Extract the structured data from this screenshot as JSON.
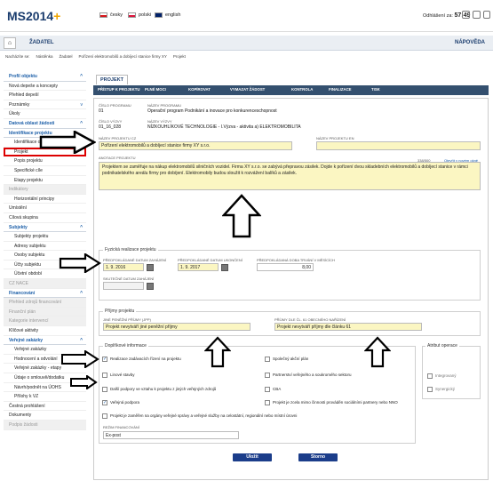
{
  "header": {
    "logo_text": "MS2014",
    "logo_plus": "+",
    "languages": [
      "česky",
      "polski",
      "english"
    ],
    "logout_label": "Odhlášení za:",
    "logout_time": "57:49"
  },
  "nav": {
    "zadatel": "ŽADATEL",
    "napoveda": "NÁPOVĚDA"
  },
  "breadcrumb": [
    "Nacházíte se:",
    "Nástěnka",
    "Žadatel",
    "Pořízení elektromobilů a dobíjecí stanice firmy XY",
    "Projekt"
  ],
  "sidebar": {
    "items": [
      {
        "label": "Profil objektu",
        "kind": "section",
        "chevron": "^"
      },
      {
        "label": "Nová depeše a koncepty",
        "kind": "item"
      },
      {
        "label": "Přehled depeší",
        "kind": "item"
      },
      {
        "label": "Poznámky",
        "kind": "item",
        "chevron": "v"
      },
      {
        "label": "Úkoly",
        "kind": "item"
      },
      {
        "label": "Datová oblast žádosti",
        "kind": "section",
        "chevron": "^"
      },
      {
        "label": "Identifikace projektu",
        "kind": "section"
      },
      {
        "label": "Identifikace operace",
        "kind": "sub"
      },
      {
        "label": "Projekt",
        "kind": "sub",
        "highlight": true
      },
      {
        "label": "Popis projektu",
        "kind": "sub"
      },
      {
        "label": "Specifické cíle",
        "kind": "sub"
      },
      {
        "label": "Etapy projektu",
        "kind": "sub"
      },
      {
        "label": "Indikátory",
        "kind": "grey"
      },
      {
        "label": "Horizontální principy",
        "kind": "sub"
      },
      {
        "label": "Umístění",
        "kind": "item"
      },
      {
        "label": "Cílová skupina",
        "kind": "item"
      },
      {
        "label": "Subjekty",
        "kind": "section",
        "chevron": "^"
      },
      {
        "label": "Subjekty projektu",
        "kind": "sub"
      },
      {
        "label": "Adresy subjektu",
        "kind": "sub"
      },
      {
        "label": "Osoby subjektu",
        "kind": "sub"
      },
      {
        "label": "Účty subjektu",
        "kind": "sub"
      },
      {
        "label": "Účetní období",
        "kind": "sub"
      },
      {
        "label": "CZ NACE",
        "kind": "grey"
      },
      {
        "label": "Financování",
        "kind": "section",
        "chevron": "^"
      },
      {
        "label": "Přehled zdrojů financování",
        "kind": "grey"
      },
      {
        "label": "Finanční plán",
        "kind": "grey"
      },
      {
        "label": "Kategorie intervencí",
        "kind": "grey"
      },
      {
        "label": "Klíčové aktivity",
        "kind": "item"
      },
      {
        "label": "Veřejné zakázky",
        "kind": "section",
        "chevron": "^"
      },
      {
        "label": "Veřejné zakázky",
        "kind": "sub"
      },
      {
        "label": "Hodnocení a odvolání",
        "kind": "sub"
      },
      {
        "label": "Veřejné zakázky - etapy",
        "kind": "sub"
      },
      {
        "label": "Údaje o smlouvě/dodatku",
        "kind": "sub"
      },
      {
        "label": "Návrh/podnět na ÚOHS",
        "kind": "sub"
      },
      {
        "label": "Přílohy k VZ",
        "kind": "sub"
      },
      {
        "label": "Čestná prohlášení",
        "kind": "item"
      },
      {
        "label": "Dokumenty",
        "kind": "item"
      },
      {
        "label": "Podpis žádosti",
        "kind": "grey"
      }
    ]
  },
  "main": {
    "tab": "PROJEKT",
    "toolbar": [
      "PŘÍSTUP K PROJEKTU",
      "PLNÉ MOCI",
      "KOPÍROVAT",
      "VYMAZAT ŽÁDOST",
      "KONTROLA",
      "FINALIZACE",
      "TISK"
    ],
    "fields": {
      "cislo_programu_label": "ČÍSLO PROGRAMU",
      "cislo_programu": "01",
      "nazev_programu_label": "NÁZEV PROGRAMU",
      "nazev_programu": "Operační program Podnikání a inovace pro konkurenceschopnost",
      "cislo_vyzvy_label": "ČÍSLO VÝZVY",
      "cislo_vyzvy": "01_16_028",
      "nazev_vyzvy_label": "NÁZEV VÝZVY",
      "nazev_vyzvy": "NÍZKOUHLÍKOVÉ TECHNOLOGIE - I.Výzva - aktivita a) ELEKTROMOBILITA",
      "nazev_cz_label": "NÁZEV PROJEKTU CZ",
      "nazev_cz": "Pořízení elektromobilů a dobíjecí stanice firmy XY s.r.o.",
      "nazev_en_label": "NÁZEV PROJEKTU EN",
      "anotace_label": "ANOTACE PROJEKTU",
      "anotace_counter": "338/500",
      "anotace_link": "Otevřít v novém okně",
      "anotace": "Projektem se zaměřuje na nákup elektromobilů silničních vozidel. Firma XY s.r.o. se zabývá přepravou zásilek. Dojde k pořízení dvou skladebních elektromobilů a dobíjecí stanice v rámci podnikatelského areálu firmy pro dobíjení. Elektromobily budou sloužit k rozvážení balíků a zásilek."
    },
    "realizace": {
      "legend": "Fyzická realizace projektu",
      "start_label": "PŘEDPOKLÁDANÉ DATUM ZAHÁJENÍ",
      "start": "1. 9. 2016",
      "end_label": "PŘEDPOKLÁDANÉ DATUM UKONČENÍ",
      "end": "1. 9. 2017",
      "duration_label": "PŘEDPOKLÁDANÁ DOBA TRVÁNÍ V MĚSÍCÍCH",
      "duration": "8,00",
      "real_start_label": "SKUTEČNÉ DATUM ZAHÁJENÍ"
    },
    "prijmy": {
      "legend": "Příjmy projektu",
      "jine_label": "JINÉ PENĚŽNÍ PŘÍJMY (JPP)",
      "jine": "Projekt nevytváří jiné peněžní příjmy",
      "cl61_label": "PŘÍJMY DLE ČL. 61 OBECNÉHO NAŘÍZENÍ",
      "cl61": "Projekt nevytváří příjmy dle článku 61"
    },
    "doplnkove": {
      "legend": "Doplňkové informace",
      "left": [
        {
          "label": "Realizace zadávacích řízení na projektu",
          "checked": true
        },
        {
          "label": "Linové stavby",
          "checked": false
        },
        {
          "label": "Další podpory ve vztahu k projektu z jiných veřejných zdrojů",
          "checked": false
        },
        {
          "label": "Veřejná podpora",
          "checked": true
        }
      ],
      "right": [
        {
          "label": "Společný akční plán",
          "checked": false
        },
        {
          "label": "Partnerství veřejného a soukromého sektoru",
          "checked": false
        },
        {
          "label": "CBA",
          "checked": false
        },
        {
          "label": "Projekt je zcela mimo činnosti prováděn sociálními partnery nebo NNO",
          "checked": false
        }
      ],
      "wide": {
        "label": "Projekt je zaměřen na orgány veřejné správy a veřejné služby na celostátní, regionální nebo místní úrovni",
        "checked": false
      },
      "rezim_label": "REŽIM FINANCOVÁNÍ",
      "rezim": "Ex-post"
    },
    "atribut": {
      "legend": "Atribut operace",
      "items": [
        "Integrovaný",
        "Synergický"
      ]
    },
    "buttons": {
      "save": "Uložit",
      "cancel": "Storno"
    }
  }
}
